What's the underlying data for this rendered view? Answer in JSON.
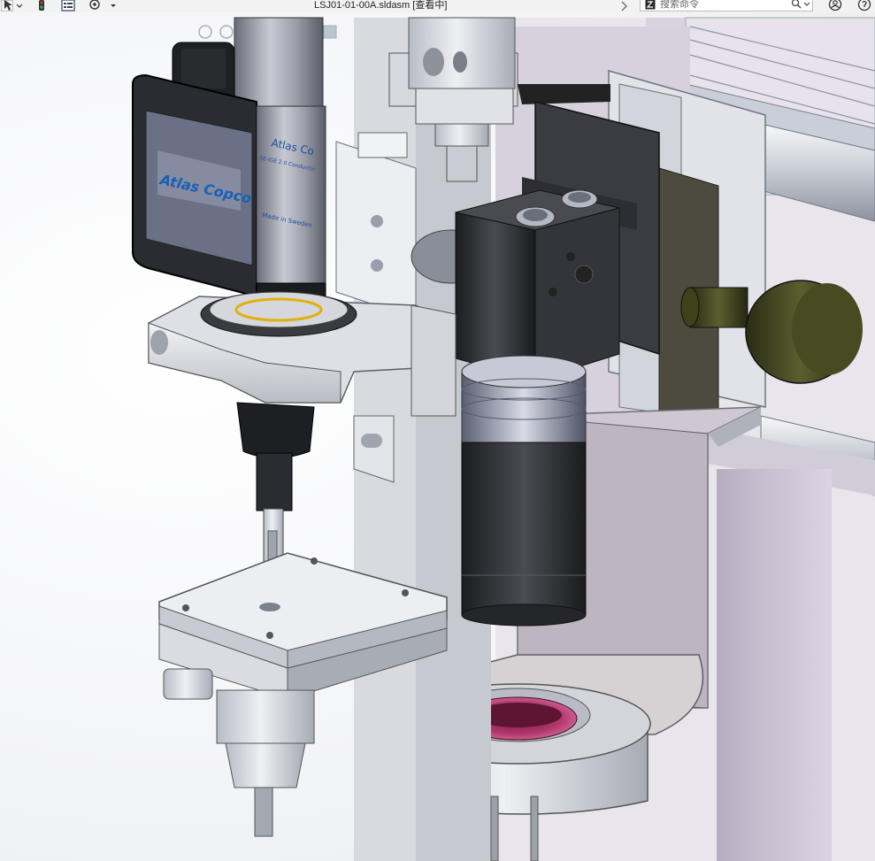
{
  "window": {
    "title": "LSJ01-01-00A.sldasm [查看中]"
  },
  "search": {
    "placeholder": "搜索命令"
  },
  "model": {
    "brand_text_1": "Atlas Co",
    "brand_text_2": "SE-IGE 2 0 Conductor",
    "brand_text_3": "Made in Sweden"
  },
  "colors": {
    "titlebar_bg": "#f2f2f2",
    "plate_metal": "#d4d6dc",
    "tool_dark": "#2c2e33",
    "knob": "#3f4320",
    "lavender_frame": "#cfc6d6",
    "magenta_ring": "#b0356a"
  }
}
